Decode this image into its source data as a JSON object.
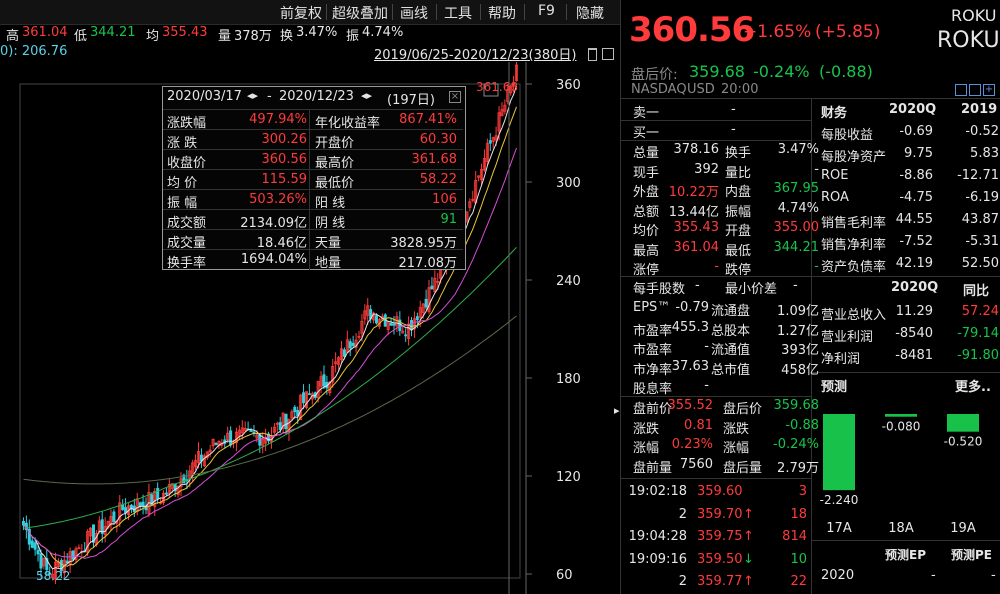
{
  "menu": {
    "items": [
      "前复权",
      "超级叠加",
      "画线",
      "工具",
      "帮助",
      "F9",
      "隐藏"
    ]
  },
  "stats": {
    "high_label": "高",
    "high": "361.04",
    "low_label": "低",
    "low": "344.21",
    "avg_label": "均",
    "avg": "355.43",
    "vol_label": "量",
    "vol": "378万",
    "turnover_label": "换",
    "turnover": "3.47%",
    "amp_label": "振",
    "amp": "4.74%",
    "ma_readout": "0): 206.76",
    "range": "2019/06/25-2020/12/23(380日)"
  },
  "chart": {
    "y_ticks": [
      "360",
      "300",
      "240",
      "180",
      "120",
      "60"
    ],
    "max_label": "361.68",
    "min_label": "58.22"
  },
  "popup": {
    "header_start": "2020/03/17",
    "header_end": "2020/12/23",
    "header_days": "(197日)",
    "rows": [
      {
        "k1": "涨跌幅",
        "v1": "497.94%",
        "k2": "年化收益率",
        "v2": "867.41%"
      },
      {
        "k1": "涨 跌",
        "v1": "300.26",
        "k2": "开盘价",
        "v2": "60.30"
      },
      {
        "k1": "收盘价",
        "v1": "360.56",
        "k2": "最高价",
        "v2": "361.68"
      },
      {
        "k1": "均 价",
        "v1": "115.59",
        "k2": "最低价",
        "v2": "58.22"
      },
      {
        "k1": "振 幅",
        "v1": "503.26%",
        "k2": "阳 线",
        "v2": "106"
      },
      {
        "k1": "成交额",
        "v1": "2134.09亿",
        "k2": "阴 线",
        "v2": "91"
      },
      {
        "k1": "成交量",
        "v1": "18.46亿",
        "k2": "天量",
        "v2": "3828.95万"
      },
      {
        "k1": "换手率",
        "v1": "1694.04%",
        "k2": "地量",
        "v2": "217.08万"
      }
    ]
  },
  "quote": {
    "price": "360.56",
    "change_pct": "+1.65%",
    "change": "(+5.85)",
    "symbol1": "ROKU",
    "symbol2": "ROKU",
    "after_label": "盘后价:",
    "after_price": "359.68",
    "after_pct": "-0.24%",
    "after_change": "(-0.88)",
    "exchange": "NASDAQ",
    "currency": "USD",
    "time": "20:00",
    "sell1_label": "卖一",
    "sell1_val": "-",
    "buy1_label": "买一",
    "buy1_val": "-",
    "rows": [
      {
        "l1": "总量",
        "v1": "378.16",
        "l2": "换手",
        "v2": "3.47%"
      },
      {
        "l1": "现手",
        "v1": "392",
        "l2": "量比",
        "v2": "-"
      },
      {
        "l1": "外盘",
        "v1": "10.22万",
        "l2": "内盘",
        "v2": "367.95"
      },
      {
        "l1": "总额",
        "v1": "13.44亿",
        "l2": "振幅",
        "v2": "4.74%"
      },
      {
        "l1": "均价",
        "v1": "355.43",
        "l2": "开盘",
        "v2": "355.00"
      },
      {
        "l1": "最高",
        "v1": "361.04",
        "l2": "最低",
        "v2": "344.21"
      },
      {
        "l1": "涨停",
        "v1": "-",
        "l2": "跌停",
        "v2": "-"
      }
    ],
    "lot_label": "每手股数",
    "lot_val": "-",
    "min_tick_label": "最小价差",
    "min_tick_val": "-",
    "rows2": [
      {
        "l1": "EPS™",
        "v1": "-0.79",
        "l2": "流通盘",
        "v2": "1.09亿"
      },
      {
        "l1": "市盈率",
        "v1": "-455.3",
        "l2": "总股本",
        "v2": "1.27亿"
      },
      {
        "l1": "市盈率",
        "v1": "-",
        "l2": "流通值",
        "v2": "393亿"
      },
      {
        "l1": "市净率",
        "v1": "37.63",
        "l2": "总市值",
        "v2": "458亿"
      },
      {
        "l1": "股息率",
        "v1": "-",
        "l2": "",
        "v2": ""
      }
    ],
    "rows3": [
      {
        "l1": "盘前价",
        "v1": "355.52",
        "l2": "盘后价",
        "v2": "359.68"
      },
      {
        "l1": "涨跌",
        "v1": "0.81",
        "l2": "涨跌",
        "v2": "-0.88"
      },
      {
        "l1": "涨幅",
        "v1": "0.23%",
        "l2": "涨幅",
        "v2": "-0.24%"
      },
      {
        "l1": "盘前量",
        "v1": "7560",
        "l2": "盘后量",
        "v2": "2.79万"
      }
    ],
    "ticks": [
      {
        "time": "19:02:18",
        "price": "359.60",
        "arrow": "",
        "vol": "3"
      },
      {
        "time": "2",
        "price": "359.70",
        "arrow": "↑",
        "vol": "18"
      },
      {
        "time": "19:04:28",
        "price": "359.75",
        "arrow": "↑",
        "vol": "814"
      },
      {
        "time": "19:09:16",
        "price": "359.50",
        "arrow": "↓",
        "vol": "10"
      },
      {
        "time": "2",
        "price": "359.77",
        "arrow": "↑",
        "vol": "22"
      }
    ]
  },
  "finance": {
    "header": {
      "c1": "财务",
      "c2": "2020Q",
      "c3": "2019"
    },
    "rows": [
      {
        "k": "每股收益",
        "a": "-0.69",
        "b": "-0.52"
      },
      {
        "k": "每股净资产",
        "a": "9.75",
        "b": "5.83"
      },
      {
        "k": "ROE",
        "a": "-8.86",
        "b": "-12.71"
      },
      {
        "k": "ROA",
        "a": "-4.75",
        "b": "-6.19"
      },
      {
        "k": "销售毛利率",
        "a": "44.55",
        "b": "43.87"
      },
      {
        "k": "销售净利率",
        "a": "-7.52",
        "b": "-5.31"
      },
      {
        "k": "资产负债率",
        "a": "42.19",
        "b": "52.50"
      }
    ],
    "header2": {
      "c2": "2020Q",
      "c3": "同比"
    },
    "rows2": [
      {
        "k": "营业总收入",
        "a": "11.29",
        "b": "57.24"
      },
      {
        "k": "营业利润",
        "a": "-8540",
        "b": "-79.14"
      },
      {
        "k": "净利润",
        "a": "-8481",
        "b": "-91.80"
      }
    ],
    "forecast_label": "预测",
    "more_label": "更多..",
    "forecast_bars": [
      {
        "label": "17A",
        "value": "-2.240"
      },
      {
        "label": "18A",
        "value": "-0.080"
      },
      {
        "label": "19A",
        "value": "-0.520"
      }
    ],
    "fc_header": {
      "c2": "预测EP",
      "c3": "预测PE"
    },
    "fc_rows": [
      {
        "k": "2020",
        "a": "-",
        "b": "-"
      }
    ]
  },
  "colors": {
    "up": "#ff3b3b",
    "down": "#17c44b",
    "ma5": "#e6e6e6",
    "ma10": "#e8c83a",
    "ma20": "#d64fd6",
    "ma60": "#2fae4a"
  }
}
